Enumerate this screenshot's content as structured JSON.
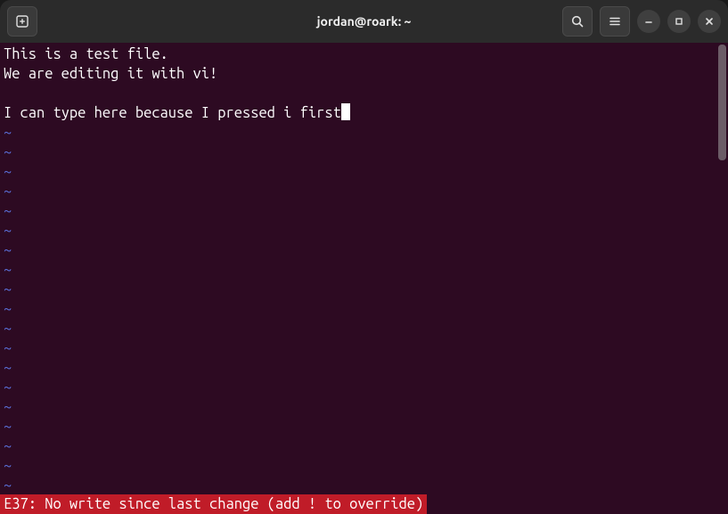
{
  "titlebar": {
    "title": "jordan@roark: ~"
  },
  "editor": {
    "lines": [
      "This is a test file.",
      "We are editing it with vi!",
      "",
      "I can type here because I pressed i first"
    ],
    "cursor_line_index": 3,
    "tilde_char": "~",
    "tilde_count": 19,
    "status_message": "E37: No write since last change (add ! to override)"
  },
  "colors": {
    "terminal_bg": "#2d0a22",
    "tilde": "#5a6fd8",
    "status_bg": "#c01c28",
    "titlebar_bg": "#2b2b2b"
  }
}
